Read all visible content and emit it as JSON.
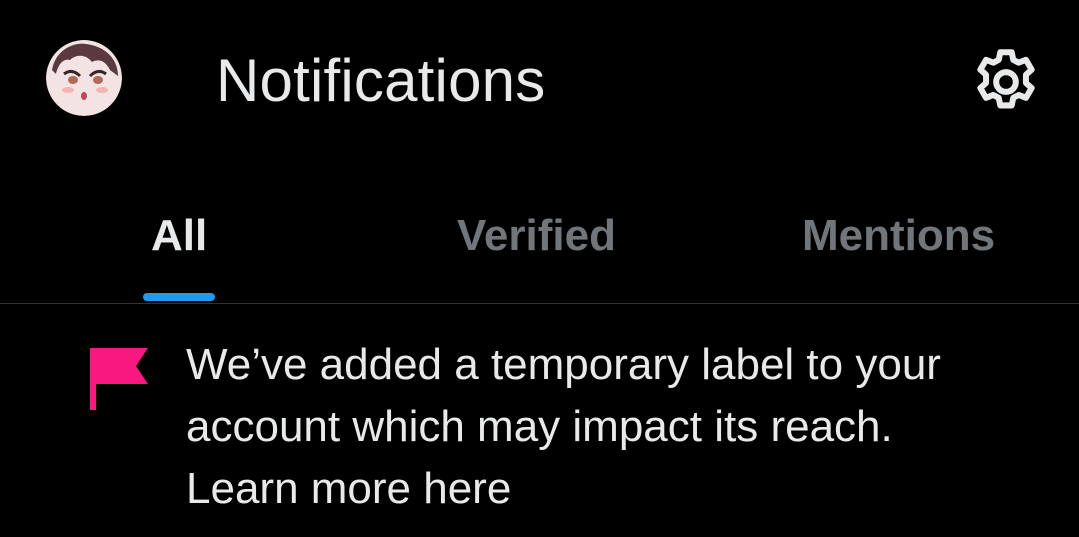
{
  "header": {
    "title": "Notifications",
    "avatar_icon": "user-avatar",
    "settings_icon": "gear-icon"
  },
  "tabs": [
    {
      "label": "All",
      "active": true
    },
    {
      "label": "Verified",
      "active": false
    },
    {
      "label": "Mentions",
      "active": false
    }
  ],
  "notice": {
    "icon": "flag-icon",
    "line1": "We’ve added a temporary label to your",
    "line2": "account which may impact its reach.",
    "line3": "Learn more here"
  },
  "colors": {
    "background": "#000000",
    "text_primary": "#e7e9ea",
    "text_secondary": "#71767b",
    "accent": "#1d9bf0",
    "flag": "#f91880",
    "divider": "#2f3336"
  }
}
